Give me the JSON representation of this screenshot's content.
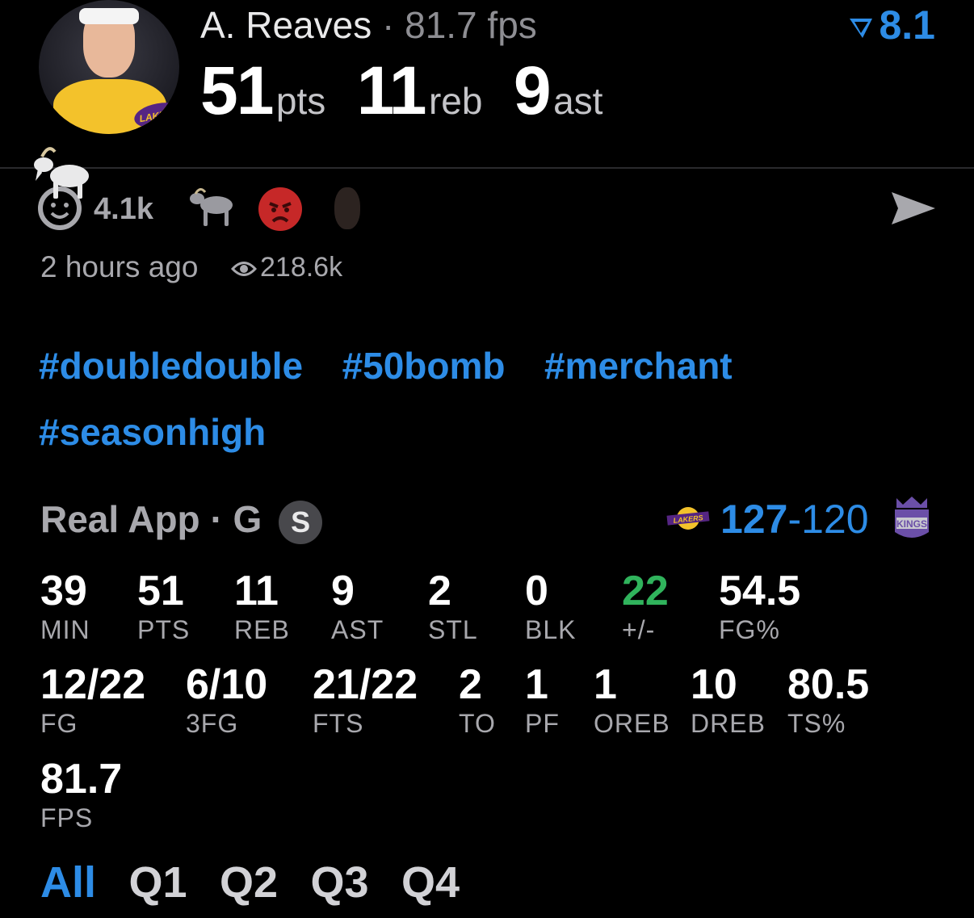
{
  "header": {
    "player_name": "A. Reaves",
    "separator": "·",
    "fps_text": "81.7 fps",
    "pts_value": "51",
    "pts_unit": "pts",
    "reb_value": "11",
    "reb_unit": "reb",
    "ast_value": "9",
    "ast_unit": "ast",
    "rating": "8.1",
    "team_logo_text": "LAKERS"
  },
  "reactions": {
    "count": "4.1k",
    "items": [
      "goat-icon",
      "angry-face-icon",
      "player-head-icon"
    ]
  },
  "meta": {
    "time": "2 hours ago",
    "views": "218.6k"
  },
  "hashtags": [
    "#doubledouble",
    "#50bomb",
    "#merchant",
    "#seasonhigh"
  ],
  "game": {
    "source": "Real App",
    "separator": "·",
    "position": "G",
    "badge": "S",
    "home_score": "127",
    "dash": "-",
    "away_score": "120",
    "home_team_logo": "LAKERS",
    "away_team_logo": "KINGS"
  },
  "stats_row1": [
    {
      "value": "39",
      "label": "MIN"
    },
    {
      "value": "51",
      "label": "PTS"
    },
    {
      "value": "11",
      "label": "REB"
    },
    {
      "value": "9",
      "label": "AST"
    },
    {
      "value": "2",
      "label": "STL"
    },
    {
      "value": "0",
      "label": "BLK"
    },
    {
      "value": "22",
      "label": "+/-"
    },
    {
      "value": "54.5",
      "label": "FG%"
    }
  ],
  "stats_row2": [
    {
      "value": "12/22",
      "label": "FG"
    },
    {
      "value": "6/10",
      "label": "3FG"
    },
    {
      "value": "21/22",
      "label": "FTS"
    },
    {
      "value": "2",
      "label": "TO"
    },
    {
      "value": "1",
      "label": "PF"
    },
    {
      "value": "1",
      "label": "OREB"
    },
    {
      "value": "10",
      "label": "DREB"
    },
    {
      "value": "80.5",
      "label": "TS%"
    }
  ],
  "stats_row3": [
    {
      "value": "81.7",
      "label": "FPS"
    }
  ],
  "tabs": [
    "All",
    "Q1",
    "Q2",
    "Q3",
    "Q4"
  ],
  "colors": {
    "accent": "#2d8ce6",
    "positive": "#30b35c",
    "muted": "#a8a8ad"
  }
}
